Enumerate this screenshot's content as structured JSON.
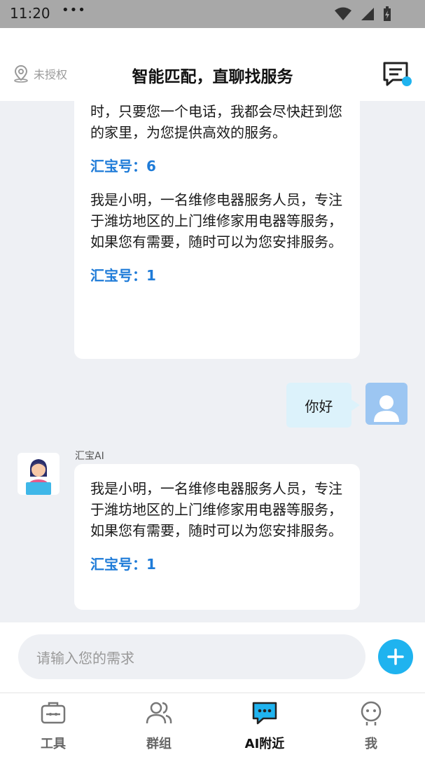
{
  "status": {
    "time": "11:20",
    "dots": "•••"
  },
  "header": {
    "location": "未授权",
    "title": "智能匹配，直聊找服务"
  },
  "chat": {
    "first_card": {
      "top_text": "我的团队经过严格的培训，技术过硬，确保每一项服务都做到专业可靠。无论何时，只要您一个电话，我都会尽快赶到您的家里，为您提供高效的服务。",
      "code_1": "汇宝号：6",
      "middle_text": "我是小明，一名维修电器服务人员，专注于潍坊地区的上门维修家用电器等服务，如果您有需要，随时可以为您安排服务。",
      "code_2": "汇宝号：1"
    },
    "user_message": "你好",
    "ai_sender": "汇宝AI",
    "ai_reply": {
      "text": "我是小明，一名维修电器服务人员，专注于潍坊地区的上门维修家用电器等服务，如果您有需要，随时可以为您安排服务。",
      "code": "汇宝号：1"
    }
  },
  "input": {
    "placeholder": "请输入您的需求"
  },
  "tabs": [
    {
      "label": "工具",
      "icon": "toolbox-icon"
    },
    {
      "label": "群组",
      "icon": "group-icon"
    },
    {
      "label": "AI附近",
      "icon": "chat-bubble-icon"
    },
    {
      "label": "我",
      "icon": "robot-face-icon"
    }
  ],
  "colors": {
    "accent": "#1fb3ef",
    "code": "#1e7bd8",
    "user_bubble": "#dcf2fb"
  }
}
